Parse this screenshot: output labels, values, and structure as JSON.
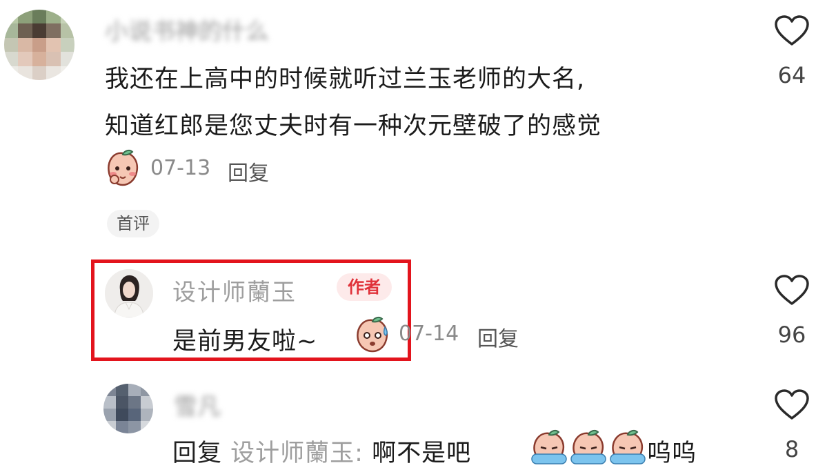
{
  "comments": [
    {
      "username": "小说书神的什么",
      "text_line1": "我还在上高中的时候就听过兰玉老师的大名,",
      "text_line2": "知道红郎是您丈夫时有一种次元壁破了的感觉",
      "date": "07-13",
      "reply_label": "回复",
      "tag": "首评",
      "likes": "64",
      "emoji": "peach-shy-emoji"
    },
    {
      "username": "设计师蘭玉",
      "badge": "作者",
      "text": "是前男友啦~",
      "date": "07-14",
      "reply_label": "回复",
      "likes": "96",
      "emoji": "peach-sweat-emoji",
      "highlight_color": "#e3141d"
    },
    {
      "username": "雪凡",
      "reply_prefix": "回复",
      "reply_to": "设计师蘭玉:",
      "text": "啊不是吧",
      "text_suffix": "呜呜",
      "likes": "8",
      "emoji": "peach-crying-emoji"
    }
  ]
}
